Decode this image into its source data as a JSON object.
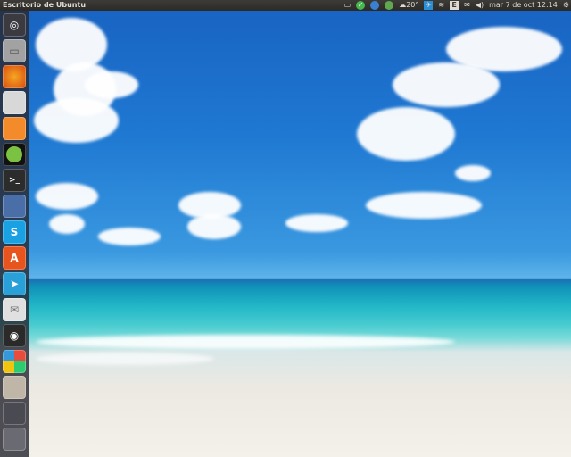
{
  "top_panel": {
    "title": "Escritorio de Ubuntu",
    "indicators": [
      {
        "name": "display-icon",
        "text": ""
      },
      {
        "name": "check-icon",
        "text": ""
      },
      {
        "name": "globe-icon",
        "text": ""
      },
      {
        "name": "sync-icon",
        "text": ""
      },
      {
        "name": "weather-icon",
        "text": "20°"
      },
      {
        "name": "app-indicator-icon",
        "text": ""
      },
      {
        "name": "wifi-icon",
        "text": ""
      },
      {
        "name": "keyboard-icon",
        "text": ""
      },
      {
        "name": "mail-icon",
        "text": ""
      },
      {
        "name": "volume-icon",
        "text": ""
      }
    ],
    "clock": "mar 7 de oct 12:14",
    "settings_icon": "gear-icon"
  },
  "launcher": {
    "items": [
      {
        "name": "dash-home-icon"
      },
      {
        "name": "files-icon"
      },
      {
        "name": "firefox-icon"
      },
      {
        "name": "image-viewer-icon"
      },
      {
        "name": "orange-app-icon"
      },
      {
        "name": "spotify-icon"
      },
      {
        "name": "terminal-icon",
        "glyph": ">_"
      },
      {
        "name": "screenshot-app-icon"
      },
      {
        "name": "skype-icon",
        "glyph": "S"
      },
      {
        "name": "software-center-icon",
        "glyph": "A"
      },
      {
        "name": "telegram-icon"
      },
      {
        "name": "mail-client-icon"
      },
      {
        "name": "steam-icon"
      },
      {
        "name": "windows-app-icon"
      },
      {
        "name": "mixer-icon"
      },
      {
        "name": "workspace-switcher-icon"
      },
      {
        "name": "trash-icon"
      }
    ]
  }
}
